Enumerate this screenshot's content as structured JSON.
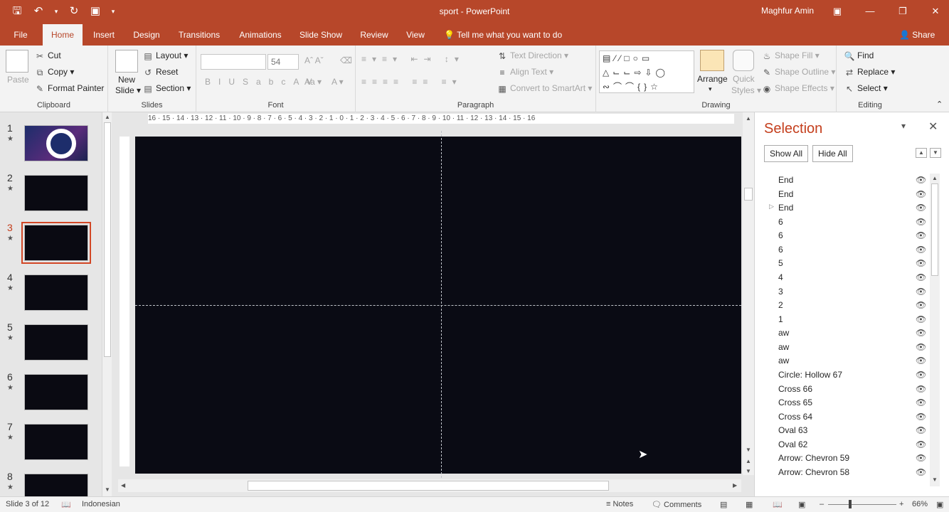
{
  "window": {
    "title": "sport  -  PowerPoint",
    "user": "Maghfur Amin",
    "share_label": "Share",
    "tell_me": "Tell me what you want to do"
  },
  "tabs": [
    "File",
    "Home",
    "Insert",
    "Design",
    "Transitions",
    "Animations",
    "Slide Show",
    "Review",
    "View"
  ],
  "ribbon": {
    "clipboard": {
      "label": "Clipboard",
      "paste": "Paste",
      "cut": "Cut",
      "copy": "Copy",
      "format_painter": "Format Painter"
    },
    "slides": {
      "label": "Slides",
      "new_slide": "New",
      "new_slide2": "Slide",
      "layout": "Layout",
      "reset": "Reset",
      "section": "Section"
    },
    "font": {
      "label": "Font",
      "font_size": "54"
    },
    "paragraph": {
      "label": "Paragraph",
      "text_direction": "Text Direction",
      "align_text": "Align Text",
      "convert_smartart": "Convert to SmartArt"
    },
    "drawing": {
      "label": "Drawing",
      "arrange": "Arrange",
      "quick_styles": "Quick",
      "quick_styles2": "Styles",
      "shape_fill": "Shape Fill",
      "shape_outline": "Shape Outline",
      "shape_effects": "Shape Effects"
    },
    "editing": {
      "label": "Editing",
      "find": "Find",
      "replace": "Replace",
      "select": "Select"
    }
  },
  "thumbnails": [
    {
      "num": "1",
      "selected": false
    },
    {
      "num": "2",
      "selected": false
    },
    {
      "num": "3",
      "selected": true
    },
    {
      "num": "4",
      "selected": false
    },
    {
      "num": "5",
      "selected": false
    },
    {
      "num": "6",
      "selected": false
    },
    {
      "num": "7",
      "selected": false
    },
    {
      "num": "8",
      "selected": false
    }
  ],
  "ruler": {
    "horizontal": "16 · 15 · 14 · 13 · 12 · 11 · 10 · 9 · 8 · 7 · 6 · 5 · 4 · 3 · 2 · 1 · 0 · 1 · 2 · 3 · 4 · 5 · 6 · 7 · 8 · 9 · 10 · 11 · 12 · 13 · 14 · 15 · 16"
  },
  "selection_pane": {
    "title": "Selection",
    "show_all": "Show All",
    "hide_all": "Hide All",
    "items": [
      "End",
      "End",
      "End",
      "6",
      "6",
      "6",
      "5",
      "4",
      "3",
      "2",
      "1",
      "aw",
      "aw",
      "aw",
      "Circle: Hollow 67",
      "Cross 66",
      "Cross 65",
      "Cross 64",
      "Oval 63",
      "Oval 62",
      "Arrow: Chevron 59",
      "Arrow: Chevron 58"
    ]
  },
  "status": {
    "slide_info": "Slide 3 of 12",
    "language": "Indonesian",
    "notes": "Notes",
    "comments": "Comments",
    "zoom": "66%"
  }
}
